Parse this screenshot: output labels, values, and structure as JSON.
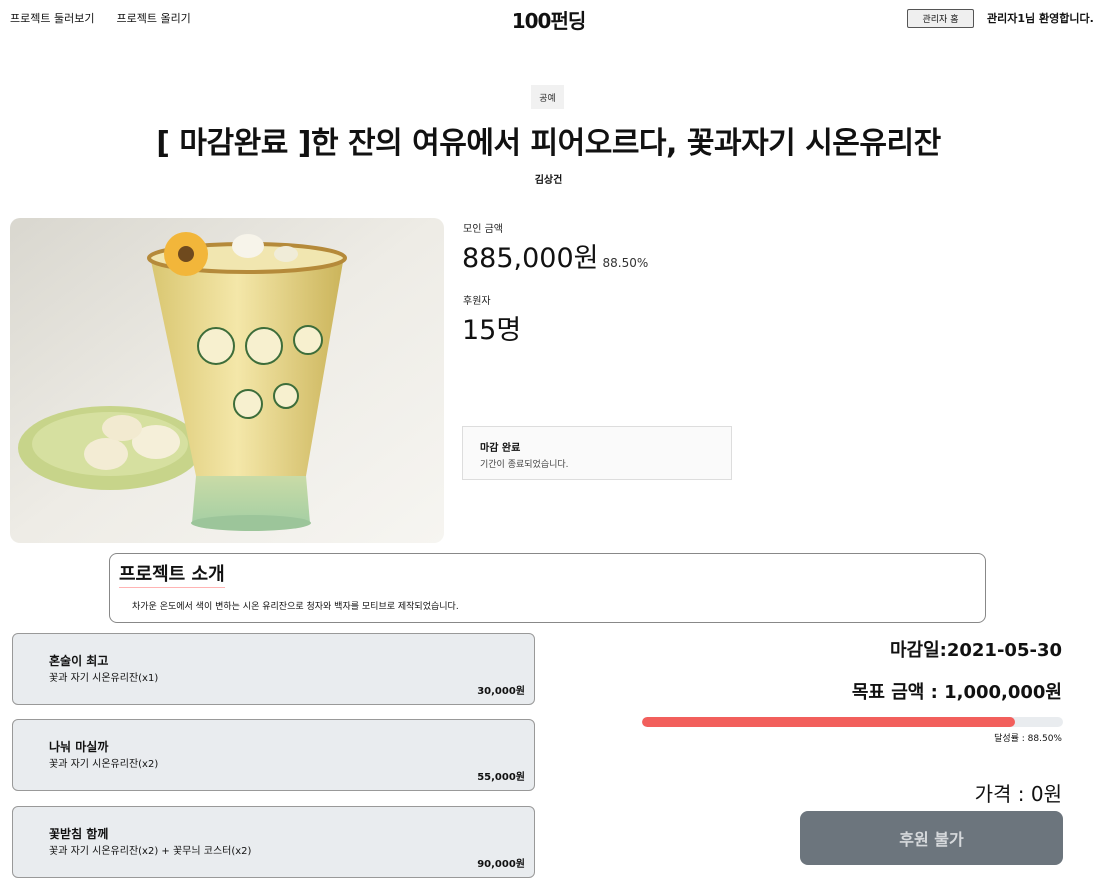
{
  "header": {
    "nav": [
      "프로젝트 둘러보기",
      "프로젝트 올리기"
    ],
    "logo": "100펀딩",
    "admin_home_label": "관리자 홈",
    "welcome": "관리자1님 환영합니다."
  },
  "project": {
    "category": "공예",
    "title": "[ 마감완료 ]한 잔의 여유에서 피어오르다, 꽃과자기 시온유리잔",
    "author": "김상건"
  },
  "stats": {
    "raised_label": "모인 금액",
    "raised_amount": "885,000원",
    "raised_percent": "88.50%",
    "backers_label": "후원자",
    "backers_count": "15명"
  },
  "status": {
    "title": "마감 완료",
    "description": "기간이 종료되었습니다."
  },
  "intro": {
    "title": "프로젝트 소개",
    "text": "차가운 온도에서 색이 변하는 시온 유리잔으로 청자와 백자를 모티브로 제작되었습니다."
  },
  "rewards": [
    {
      "name": "혼술이 최고",
      "desc": "꽃과 자기 시온유리잔(x1)",
      "price": "30,000원"
    },
    {
      "name": "나눠 마실까",
      "desc": "꽃과 자기 시온유리잔(x2)",
      "price": "55,000원"
    },
    {
      "name": "꽃받침 함께",
      "desc": "꽃과 자기 시온유리잔(x2) + 꽃무늬 코스터(x2)",
      "price": "90,000원"
    }
  ],
  "summary": {
    "deadline": "마감일:2021-05-30",
    "goal": "목표 금액 : 1,000,000원",
    "progress_fraction": 0.885,
    "rate_text": "달성률 : 88.50%",
    "price": "가격 : 0원",
    "button_label": "후원 불가"
  },
  "colors": {
    "progress": "#f25f5c",
    "button": "#6c757d",
    "reward_bg": "#e9ecef"
  }
}
